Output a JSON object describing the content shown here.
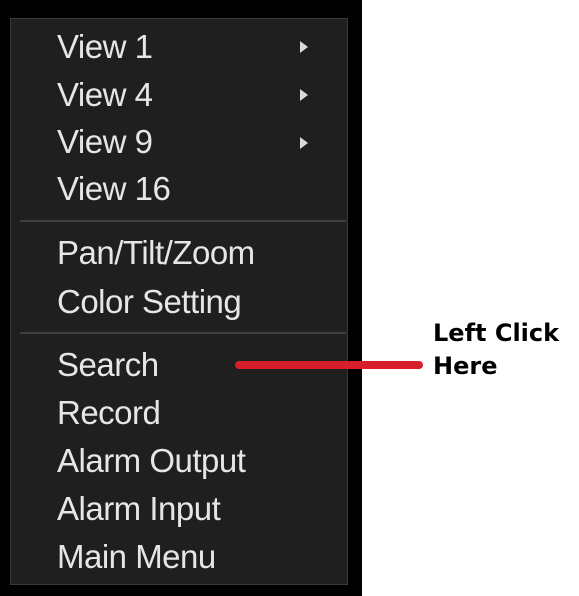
{
  "menu": {
    "group1": [
      {
        "label": "View 1",
        "has_submenu": true
      },
      {
        "label": "View 4",
        "has_submenu": true
      },
      {
        "label": "View 9",
        "has_submenu": true
      },
      {
        "label": "View 16",
        "has_submenu": false
      }
    ],
    "group2": [
      {
        "label": "Pan/Tilt/Zoom"
      },
      {
        "label": "Color Setting"
      }
    ],
    "group3": [
      {
        "label": "Search"
      },
      {
        "label": "Record"
      },
      {
        "label": "Alarm Output"
      },
      {
        "label": "Alarm Input"
      },
      {
        "label": "Main Menu"
      }
    ]
  },
  "annotation": {
    "line1": "Left Click",
    "line2": "Here",
    "pointer_color": "#d81e2a"
  },
  "colors": {
    "menu_background": "#1f1f1f",
    "menu_text": "#e6e6e6",
    "outer_background": "#000000"
  },
  "icons": {
    "submenu_indicator": "triangle-right-icon"
  }
}
